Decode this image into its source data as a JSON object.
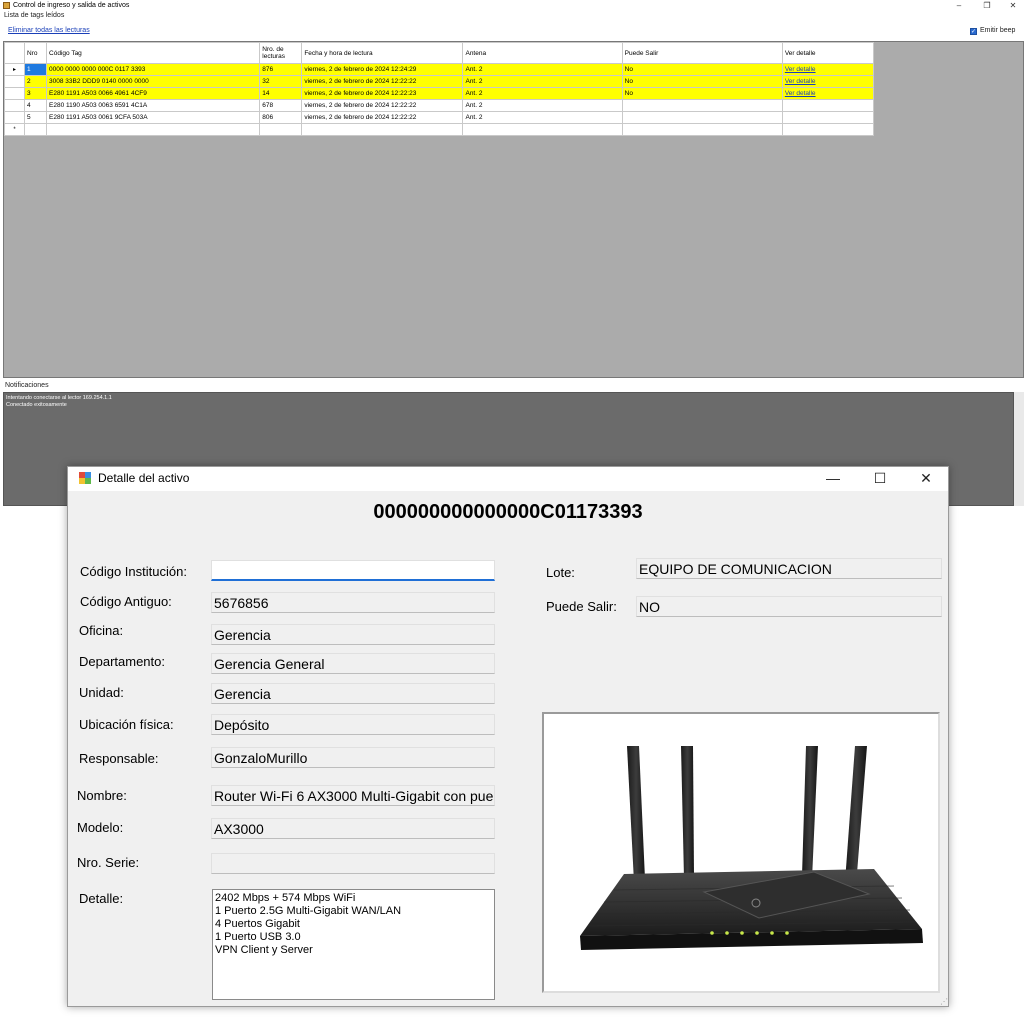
{
  "main_window": {
    "title": "Control de ingreso y salida de activos",
    "group_label": "Lista de tags leídos",
    "clear_link": "Eliminar todas las lecturas",
    "beep_label": "Emitir beep",
    "beep_checked": true,
    "controls": {
      "minimize": "–",
      "maximize": "❐",
      "close": "✕"
    }
  },
  "grid": {
    "headers": [
      "Nro",
      "Código Tag",
      "Nro. de lecturas",
      "Fecha y hora de lectura",
      "Antena",
      "Puede Salir",
      "Ver detalle"
    ],
    "rows": [
      {
        "nro": "1",
        "tag": "0000 0000 0000 000C 0117 3393",
        "lecturas": "876",
        "fecha": "viernes, 2 de febrero de 2024 12:24:29",
        "antena": "Ant. 2",
        "salir": "No",
        "link": "Ver detalle",
        "highlight": true
      },
      {
        "nro": "2",
        "tag": "3008 33B2 DDD9 0140 0000 0000",
        "lecturas": "32",
        "fecha": "viernes, 2 de febrero de 2024 12:22:22",
        "antena": "Ant. 2",
        "salir": "No",
        "link": "Ver detalle",
        "highlight": true
      },
      {
        "nro": "3",
        "tag": "E280 1191 A503 0066 4961 4CF9",
        "lecturas": "14",
        "fecha": "viernes, 2 de febrero de 2024 12:22:23",
        "antena": "Ant. 2",
        "salir": "No",
        "link": "Ver detalle",
        "highlight": true
      },
      {
        "nro": "4",
        "tag": "E280 1190 A503 0063 6591 4C1A",
        "lecturas": "678",
        "fecha": "viernes, 2 de febrero de 2024 12:22:22",
        "antena": "Ant. 2",
        "salir": "",
        "link": "",
        "highlight": false
      },
      {
        "nro": "5",
        "tag": "E280 1191 A503 0061 9CFA 503A",
        "lecturas": "806",
        "fecha": "viernes, 2 de febrero de 2024 12:22:22",
        "antena": "Ant. 2",
        "salir": "",
        "link": "",
        "highlight": false
      }
    ],
    "current_row_marker": "▸",
    "new_row_marker": "*"
  },
  "notifications": {
    "label": "Notificaciones",
    "lines": [
      "Intentando conectarse al lector 169.254.1.1",
      "Conectado exitosamente"
    ]
  },
  "dialog": {
    "title": "Detalle del activo",
    "controls": {
      "minimize": "—",
      "maximize": "☐",
      "close": "✕"
    },
    "asset_code": "000000000000000C01173393",
    "fields": {
      "codigo_institucion": {
        "label": "Código Institución:",
        "value": ""
      },
      "codigo_antiguo": {
        "label": "Código Antiguo:",
        "value": "5676856"
      },
      "oficina": {
        "label": "Oficina:",
        "value": "Gerencia"
      },
      "departamento": {
        "label": "Departamento:",
        "value": "Gerencia General"
      },
      "unidad": {
        "label": "Unidad:",
        "value": "Gerencia"
      },
      "ubicacion": {
        "label": "Ubicación física:",
        "value": "Depósito"
      },
      "responsable": {
        "label": "Responsable:",
        "value": "GonzaloMurillo"
      },
      "nombre": {
        "label": "Nombre:",
        "value": "Router Wi-Fi 6 AX3000 Multi-Gigabit con pue"
      },
      "modelo": {
        "label": "Modelo:",
        "value": "AX3000"
      },
      "nro_serie": {
        "label": "Nro. Serie:",
        "value": ""
      },
      "detalle": {
        "label": "Detalle:",
        "value": "2402 Mbps + 574 Mbps WiFi\n1 Puerto 2.5G Multi-Gigabit WAN/LAN\n4 Puertos Gigabit\n1 Puerto USB 3.0\nVPN Client y Server"
      },
      "lote": {
        "label": "Lote:",
        "value": "EQUIPO DE COMUNICACION"
      },
      "puede_salir": {
        "label": "Puede Salir:",
        "value": "NO"
      }
    },
    "image_icon": "router-image"
  }
}
